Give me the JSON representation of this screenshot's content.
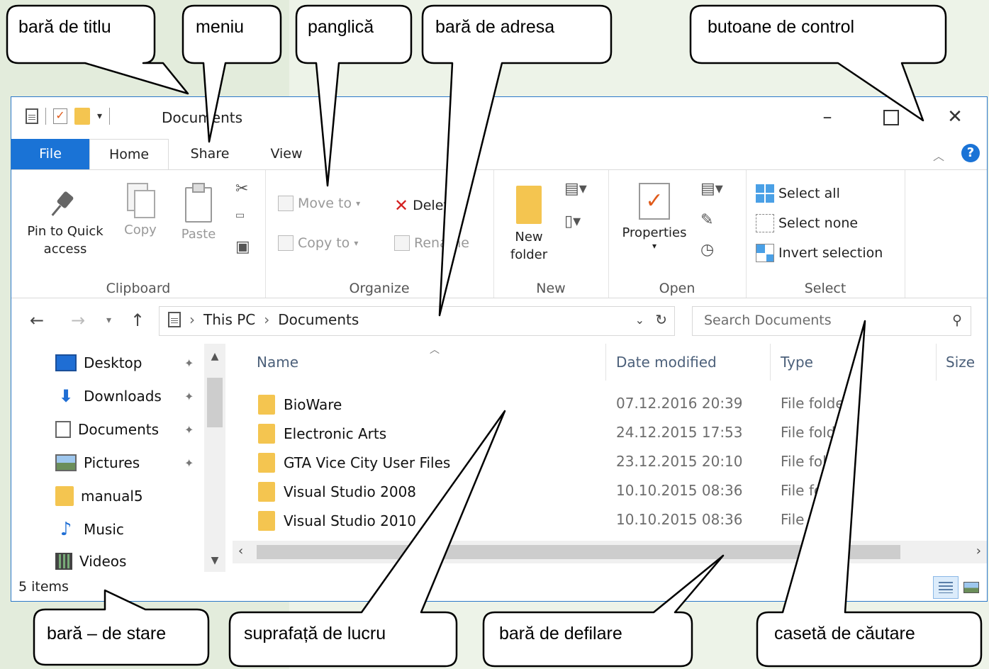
{
  "window": {
    "title": "Documents"
  },
  "window_controls": {
    "minimize": "–",
    "maximize": "",
    "close": "✕"
  },
  "tabs": [
    "File",
    "Home",
    "Share",
    "View"
  ],
  "ribbon": {
    "clipboard": {
      "pin": "Pin to Quick access",
      "copy": "Copy",
      "paste": "Paste",
      "label": "Clipboard"
    },
    "organize": {
      "move_to": "Move to",
      "copy_to": "Copy to",
      "delete": "Delete",
      "rename": "Rename",
      "label": "Organize"
    },
    "new": {
      "new_folder": "New folder",
      "label": "New"
    },
    "open": {
      "properties": "Properties",
      "label": "Open"
    },
    "select": {
      "select_all": "Select all",
      "select_none": "Select none",
      "invert": "Invert selection",
      "label": "Select"
    }
  },
  "address": {
    "crumbs": [
      "This PC",
      "Documents"
    ],
    "search_placeholder": "Search Documents"
  },
  "nav": [
    {
      "label": "Desktop",
      "icon": "desktop-icon",
      "pinned": true
    },
    {
      "label": "Downloads",
      "icon": "download-icon",
      "pinned": true
    },
    {
      "label": "Documents",
      "icon": "documents-icon",
      "pinned": true
    },
    {
      "label": "Pictures",
      "icon": "pictures-icon",
      "pinned": true
    },
    {
      "label": "manual5",
      "icon": "folder-icon",
      "pinned": false
    },
    {
      "label": "Music",
      "icon": "music-icon",
      "pinned": false
    },
    {
      "label": "Videos",
      "icon": "videos-icon",
      "pinned": false
    }
  ],
  "columns": {
    "name": "Name",
    "date": "Date modified",
    "type": "Type",
    "size": "Size"
  },
  "files": [
    {
      "name": "BioWare",
      "date": "07.12.2016 20:39",
      "type": "File folde"
    },
    {
      "name": "Electronic Arts",
      "date": "24.12.2015 17:53",
      "type": "File fold"
    },
    {
      "name": "GTA Vice City User Files",
      "date": "23.12.2015 20:10",
      "type": "File fol"
    },
    {
      "name": "Visual Studio 2008",
      "date": "10.10.2015 08:36",
      "type": "File fo"
    },
    {
      "name": "Visual Studio 2010",
      "date": "10.10.2015 08:36",
      "type": "File f"
    }
  ],
  "status": {
    "items": "5 items"
  },
  "callouts": {
    "title_bar": "bară de titlu",
    "menu": "meniu",
    "ribbon": "panglică",
    "address_bar": "bară de adresa",
    "control_buttons": "butoane de control",
    "status_bar": "bară – de stare",
    "workspace": "suprafață de lucru",
    "scrollbar": "bară de defilare",
    "search_box": "casetă de căutare"
  }
}
